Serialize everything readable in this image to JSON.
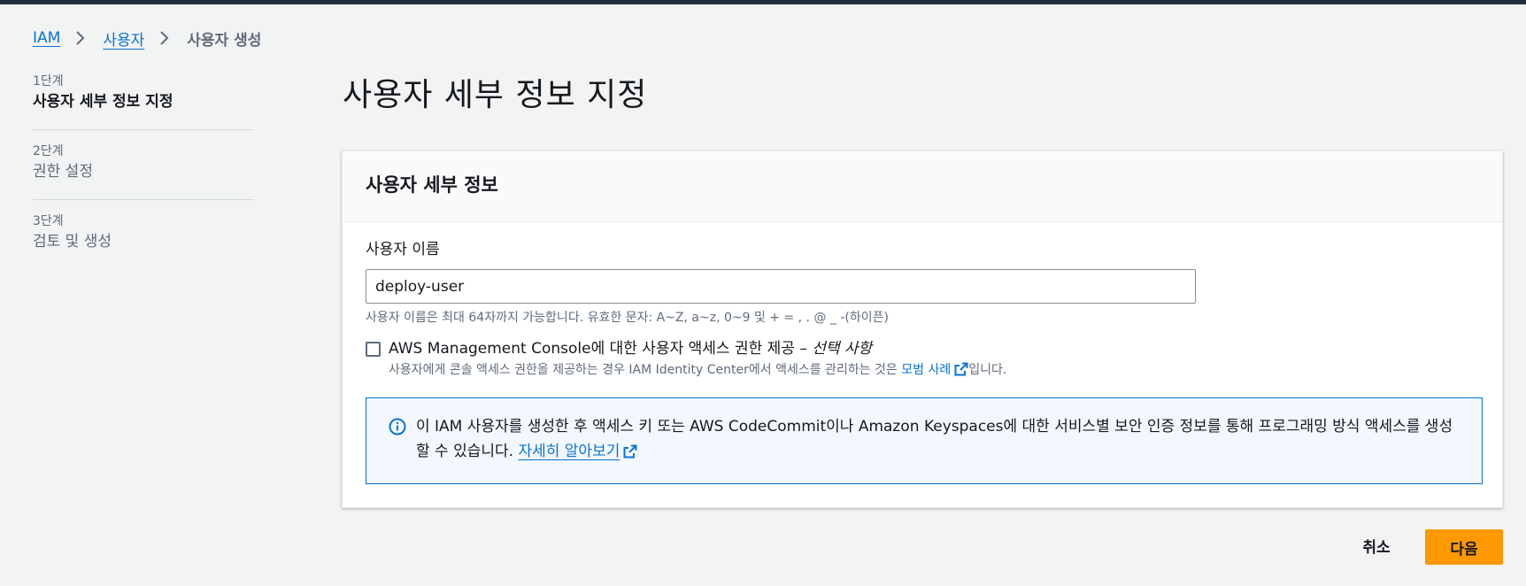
{
  "breadcrumb": {
    "items": [
      "IAM",
      "사용자"
    ],
    "current": "사용자 생성"
  },
  "steps": [
    {
      "number": "1단계",
      "title": "사용자 세부 정보 지정",
      "active": true
    },
    {
      "number": "2단계",
      "title": "권한 설정",
      "active": false
    },
    {
      "number": "3단계",
      "title": "검토 및 생성",
      "active": false
    }
  ],
  "page_title": "사용자 세부 정보 지정",
  "container": {
    "header": "사용자 세부 정보",
    "username": {
      "label": "사용자 이름",
      "value": "deploy-user",
      "constraint": "사용자 이름은 최대 64자까지 가능합니다. 유효한 문자: A~Z, a~z, 0~9 및 + = , . @ _ -(하이픈)"
    },
    "console_access": {
      "label": "AWS Management Console에 대한 사용자 액세스 권한 제공 – ",
      "optional": "선택 사항",
      "checked": false,
      "desc_prefix": "사용자에게 콘솔 액세스 권한을 제공하는 경우 IAM Identity Center에서 액세스를 관리하는 것은 ",
      "desc_link": "모범 사례",
      "desc_suffix": "입니다."
    },
    "info": {
      "text": "이 IAM 사용자를 생성한 후 액세스 키 또는 AWS CodeCommit이나 Amazon Keyspaces에 대한 서비스별 보안 인증 정보를 통해 프로그래밍 방식 액세스를 생성할 수 있습니다. ",
      "link": "자세히 알아보기"
    }
  },
  "actions": {
    "cancel": "취소",
    "next": "다음"
  },
  "colors": {
    "link": "#0972d3",
    "primary_button": "#ff9900",
    "topbar": "#232f3e"
  }
}
